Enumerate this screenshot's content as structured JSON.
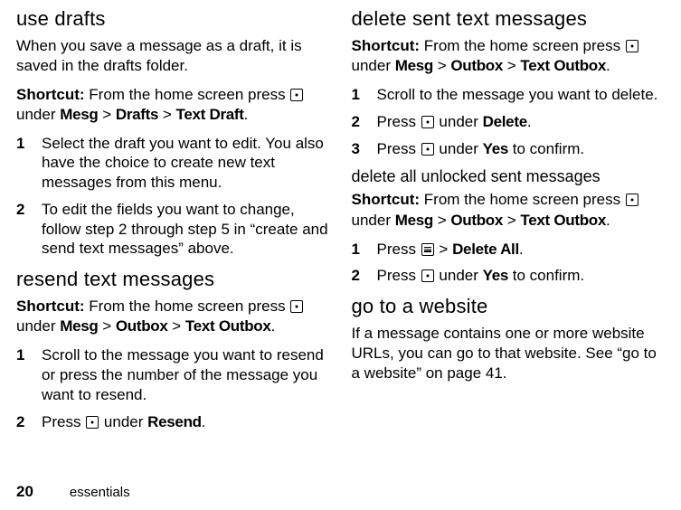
{
  "left": {
    "h1": "use drafts",
    "p1": "When you save a message as a draft, it is saved in the drafts folder.",
    "shortcut_label": "Shortcut:",
    "shortcut_pre": " From the home screen press ",
    "shortcut_under": " under ",
    "path1a": "Mesg",
    "path1b": "Drafts",
    "path1c": "Text Draft",
    "steps1": [
      {
        "n": "1",
        "text": "Select the draft you want to edit. You also have the choice to create new text messages from this menu."
      },
      {
        "n": "2",
        "text": "To edit the fields you want to change, follow step 2 through step 5 in “create and send text messages” above."
      }
    ],
    "h2": "resend text messages",
    "path2a": "Mesg",
    "path2b": "Outbox",
    "path2c": "Text Outbox",
    "steps2": [
      {
        "n": "1",
        "text": "Scroll to the message you want to resend or press the number of the message you want to resend."
      }
    ],
    "step2_2_n": "2",
    "step2_2_pre": "Press ",
    "step2_2_under": " under ",
    "step2_2_label": "Resend"
  },
  "right": {
    "h1": "delete sent text messages",
    "shortcut_label": "Shortcut:",
    "shortcut_pre": " From the home screen press ",
    "shortcut_under": " under ",
    "path1a": "Mesg",
    "path1b": "Outbox",
    "path1c": "Text Outbox",
    "step1_n": "1",
    "step1_text": "Scroll to the message you want to delete.",
    "step2_n": "2",
    "step2_pre": "Press ",
    "step2_under": " under ",
    "step2_label": "Delete",
    "step3_n": "3",
    "step3_pre": "Press ",
    "step3_under": " under ",
    "step3_label": "Yes",
    "step3_post": " to confirm.",
    "h2": "delete all unlocked sent messages",
    "path2a": "Mesg",
    "path2b": "Outbox",
    "path2c": "Text Outbox",
    "b_step1_n": "1",
    "b_step1_pre": "Press ",
    "b_step1_sep": " > ",
    "b_step1_label": "Delete All",
    "b_step2_n": "2",
    "b_step2_pre": "Press ",
    "b_step2_under": " under ",
    "b_step2_label": "Yes",
    "b_step2_post": " to confirm.",
    "h3": "go to a website",
    "p_web": "If a message contains one or more website URLs, you can go to that website. See “go to a website” on page 41."
  },
  "footer": {
    "page": "20",
    "label": "essentials"
  },
  "gt": " > ",
  "period": "."
}
